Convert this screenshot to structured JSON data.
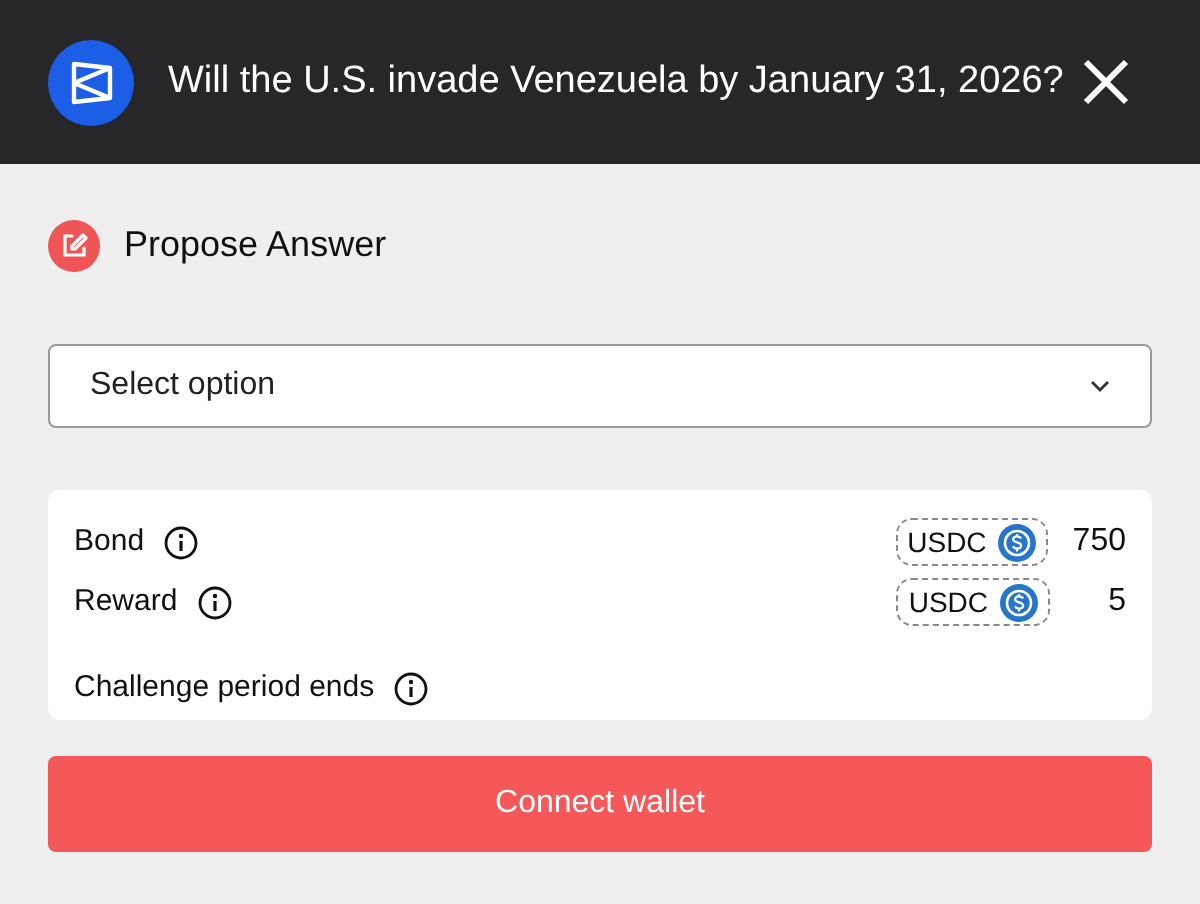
{
  "header": {
    "title": "Will the U.S. invade Venezuela by January 31, 2026?"
  },
  "section": {
    "title": "Propose Answer"
  },
  "select": {
    "placeholder": "Select option"
  },
  "details": [
    {
      "kind": "amount",
      "label": "Bond",
      "token": "USDC",
      "amount": "750"
    },
    {
      "kind": "amount",
      "label": "Reward",
      "token": "USDC",
      "amount": "5"
    },
    {
      "kind": "plain",
      "label": "Challenge period ends"
    }
  ],
  "button": {
    "label": "Connect wallet"
  }
}
